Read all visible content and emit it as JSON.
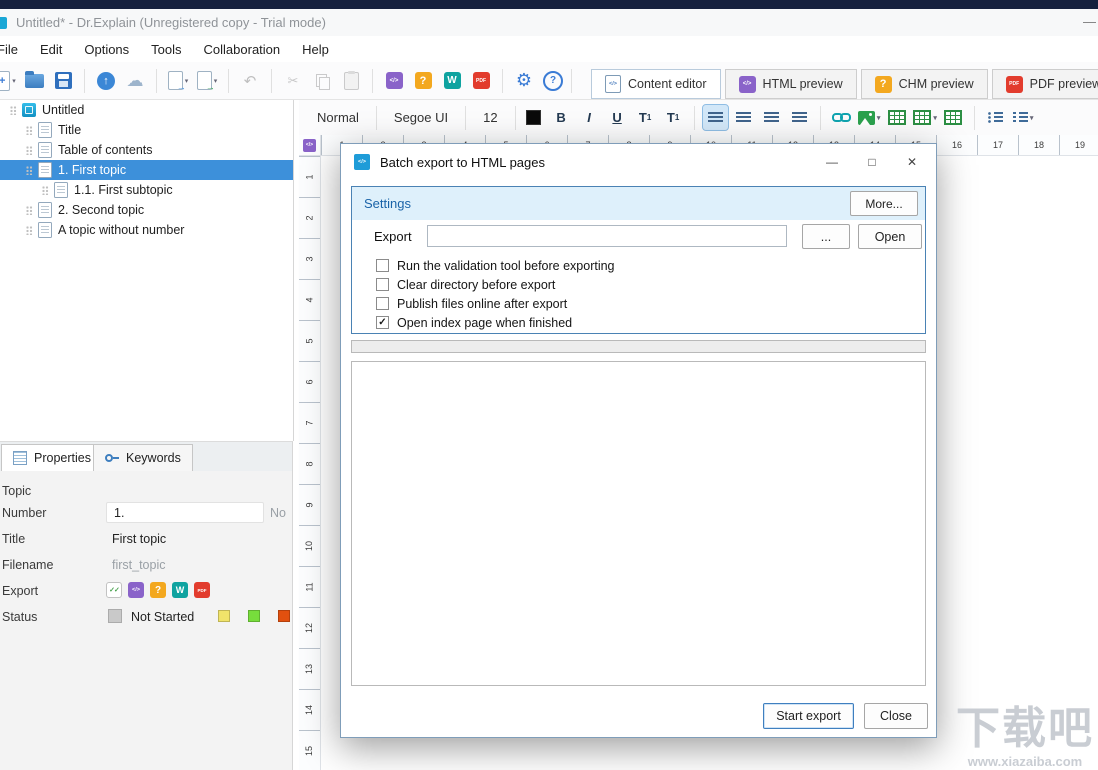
{
  "titlebar": {
    "title": "Untitled* - Dr.Explain (Unregistered copy - Trial mode)",
    "minimize_glyph": "—"
  },
  "menu": {
    "items": [
      "File",
      "Edit",
      "Options",
      "Tools",
      "Collaboration",
      "Help"
    ]
  },
  "toolbar": {
    "icons": [
      {
        "name": "new-document",
        "dropdown": true
      },
      {
        "name": "open-project"
      },
      {
        "name": "save-project"
      },
      {
        "separator": true
      },
      {
        "name": "upload-cloud"
      },
      {
        "name": "cloud-storage"
      },
      {
        "separator": true
      },
      {
        "name": "export-document",
        "dropdown": true
      },
      {
        "name": "send-document",
        "dropdown": true
      },
      {
        "separator": true
      },
      {
        "name": "undo",
        "disabled": true
      },
      {
        "separator": true
      },
      {
        "name": "cut",
        "disabled": true
      },
      {
        "name": "copy",
        "disabled": true
      },
      {
        "name": "paste",
        "disabled": true
      },
      {
        "separator": true
      },
      {
        "name": "html-export"
      },
      {
        "name": "chm-export"
      },
      {
        "name": "word-export"
      },
      {
        "name": "pdf-export"
      },
      {
        "separator": true
      },
      {
        "name": "settings-gear"
      },
      {
        "name": "help"
      }
    ],
    "tabs": [
      {
        "label": "Content editor",
        "icon": "content-editor",
        "active": true
      },
      {
        "label": "HTML preview",
        "icon": "html"
      },
      {
        "label": "CHM preview",
        "icon": "chm"
      },
      {
        "label": "PDF preview",
        "icon": "pdf"
      }
    ]
  },
  "format_bar": {
    "style": "Normal",
    "font": "Segoe UI",
    "size": "12",
    "buttons": [
      {
        "name": "text-color"
      },
      {
        "name": "bold",
        "label": "B"
      },
      {
        "name": "italic",
        "label": "I"
      },
      {
        "name": "underline",
        "label": "U"
      },
      {
        "name": "subscript",
        "label": "T1"
      },
      {
        "name": "superscript",
        "label": "T1"
      },
      {
        "sep": true
      },
      {
        "name": "align-left",
        "active": true
      },
      {
        "name": "align-center"
      },
      {
        "name": "align-right"
      },
      {
        "name": "align-justify"
      },
      {
        "sep": true
      },
      {
        "name": "link"
      },
      {
        "name": "insert-image",
        "dropdown": true
      },
      {
        "name": "insert-table"
      },
      {
        "name": "insert-block",
        "dropdown": true
      },
      {
        "name": "table-grid"
      },
      {
        "sep": true
      },
      {
        "name": "bullet-list"
      },
      {
        "name": "numbered-list",
        "dropdown": true
      }
    ]
  },
  "tree": {
    "items": [
      {
        "label": "Untitled",
        "level": 0,
        "type": "root"
      },
      {
        "label": "Title",
        "level": 1
      },
      {
        "label": "Table of contents",
        "level": 1
      },
      {
        "label": "1. First topic",
        "level": 1,
        "selected": true
      },
      {
        "label": "1.1. First subtopic",
        "level": 2
      },
      {
        "label": "2. Second topic",
        "level": 1
      },
      {
        "label": "A topic without number",
        "level": 1
      }
    ]
  },
  "panel_tabs": {
    "properties": "Properties",
    "keywords": "Keywords"
  },
  "properties": {
    "section": "Topic",
    "number_label": "Number",
    "number_value": "1.",
    "number_extra": "No",
    "title_label": "Title",
    "title_value": "First topic",
    "filename_label": "Filename",
    "filename_value": "first_topic",
    "export_label": "Export",
    "export_icons": [
      "export-check",
      "html",
      "chm",
      "word",
      "pdf"
    ],
    "status_label": "Status",
    "status_value": "Not Started",
    "status_current_color": "#c9c9c9",
    "status_colors": [
      "#f0e36a",
      "#77dd3c",
      "#e2500f"
    ]
  },
  "ruler": {
    "horizontal": [
      "1",
      "2",
      "3",
      "4",
      "5",
      "6",
      "7",
      "8",
      "9",
      "10",
      "11",
      "12",
      "13",
      "14",
      "15",
      "16",
      "17",
      "18",
      "19"
    ],
    "vertical": [
      "1",
      "2",
      "3",
      "4",
      "5",
      "6",
      "7",
      "8",
      "9",
      "10",
      "11",
      "12",
      "13",
      "14",
      "15"
    ]
  },
  "dialog": {
    "title": "Batch export to HTML pages",
    "minimize_glyph": "—",
    "maximize_glyph": "□",
    "close_glyph": "✕",
    "settings_label": "Settings",
    "more_button": "More...",
    "export_label": "Export",
    "export_path": "",
    "browse_button": "...",
    "open_button": "Open",
    "options": [
      {
        "label": "Run the validation tool before exporting",
        "checked": false
      },
      {
        "label": "Clear directory before export",
        "checked": false
      },
      {
        "label": "Publish files online after export",
        "checked": false
      },
      {
        "label": "Open index page when finished",
        "checked": true
      }
    ],
    "start_button": "Start export",
    "close_button": "Close"
  },
  "watermark": {
    "title": "下载吧",
    "url": "www.xiazaiba.com"
  }
}
